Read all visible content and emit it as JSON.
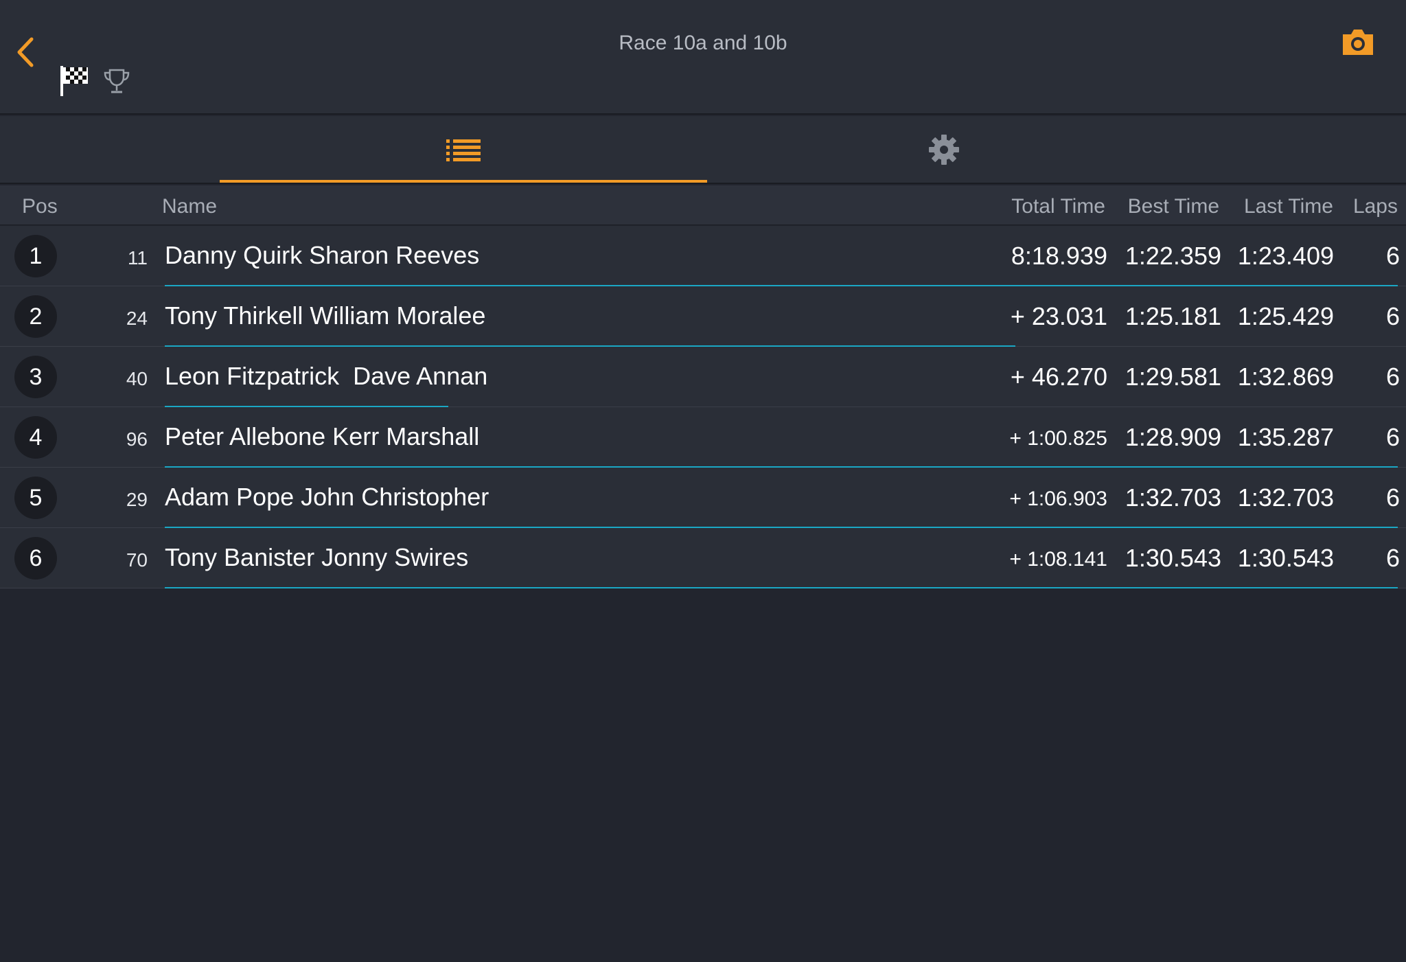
{
  "header": {
    "title": "Race 10a and 10b"
  },
  "icons": {
    "back": "chevron-left-icon",
    "flag": "checkered-flag-icon",
    "trophy": "trophy-icon",
    "camera": "camera-icon",
    "list": "list-icon",
    "settings": "gear-icon"
  },
  "colors": {
    "accent": "#f29b27",
    "progress": "#1aa7c4"
  },
  "table": {
    "columns": {
      "pos": "Pos",
      "name": "Name",
      "total": "Total Time",
      "best": "Best Time",
      "last": "Last Time",
      "laps": "Laps"
    },
    "rows": [
      {
        "pos": "1",
        "num": "11",
        "name": "Danny Quirk Sharon Reeves",
        "total": "8:18.939",
        "best": "1:22.359",
        "last": "1:23.409",
        "laps": "6",
        "progress": 1.0
      },
      {
        "pos": "2",
        "num": "24",
        "name": "Tony Thirkell William Moralee",
        "total": "+ 23.031",
        "best": "1:25.181",
        "last": "1:25.429",
        "laps": "6",
        "progress": 0.69
      },
      {
        "pos": "3",
        "num": "40",
        "name": "Leon Fitzpatrick  Dave Annan",
        "total": "+ 46.270",
        "best": "1:29.581",
        "last": "1:32.869",
        "laps": "6",
        "progress": 0.23
      },
      {
        "pos": "4",
        "num": "96",
        "name": "Peter Allebone Kerr Marshall",
        "total": "+ 1:00.825",
        "best": "1:28.909",
        "last": "1:35.287",
        "laps": "6",
        "progress": 1.0
      },
      {
        "pos": "5",
        "num": "29",
        "name": "Adam Pope John Christopher",
        "total": "+ 1:06.903",
        "best": "1:32.703",
        "last": "1:32.703",
        "laps": "6",
        "progress": 1.0
      },
      {
        "pos": "6",
        "num": "70",
        "name": "Tony Banister Jonny Swires",
        "total": "+ 1:08.141",
        "best": "1:30.543",
        "last": "1:30.543",
        "laps": "6",
        "progress": 1.0
      }
    ]
  }
}
